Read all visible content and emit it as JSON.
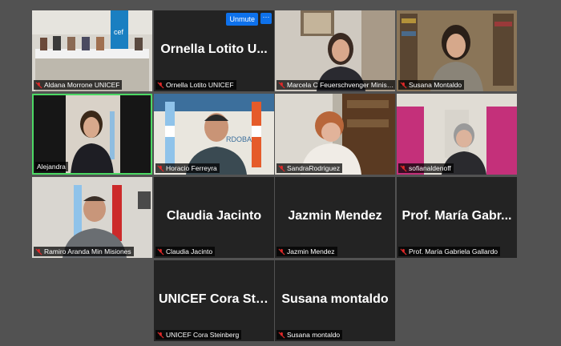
{
  "overlay": {
    "unmute_label": "Unmute",
    "more_label": "···"
  },
  "tiles": [
    {
      "id": "aldana",
      "video": true,
      "label": "Aldana Morrone UNICEF"
    },
    {
      "id": "ornella",
      "video": false,
      "name": "Ornella Lotito U...",
      "label": "Ornella Lotito UNICEF"
    },
    {
      "id": "marcela",
      "video": true,
      "label": "Marcela C Feuerschvenger Ministra ..."
    },
    {
      "id": "susana1",
      "video": true,
      "label": "Susana Montaldo"
    },
    {
      "id": "alejandra",
      "video": true,
      "label": "Alejandra",
      "active": true
    },
    {
      "id": "horacio",
      "video": true,
      "label": "Horacio Ferreyra"
    },
    {
      "id": "sandra",
      "video": true,
      "label": "SandraRodriguez"
    },
    {
      "id": "sofiana",
      "video": true,
      "label": "sofianaldenoff"
    },
    {
      "id": "ramiro",
      "video": true,
      "label": "Ramiro Aranda Min Misiones"
    },
    {
      "id": "claudia",
      "video": false,
      "name": "Claudia Jacinto",
      "label": "Claudia Jacinto"
    },
    {
      "id": "jazmin",
      "video": false,
      "name": "Jazmin Mendez",
      "label": "Jazmin Mendez"
    },
    {
      "id": "maria",
      "video": false,
      "name": "Prof. María Gabr...",
      "label": "Prof. María Gabriela Gallardo"
    },
    {
      "id": "cora",
      "video": false,
      "name": "UNICEF Cora Ste...",
      "label": "UNICEF Cora Steinberg"
    },
    {
      "id": "susana2",
      "video": false,
      "name": "Susana montaldo",
      "label": "Susana montaldo"
    }
  ],
  "colors": {
    "active_border": "#4cd964",
    "button": "#0e71eb",
    "muted": "#e02828"
  }
}
